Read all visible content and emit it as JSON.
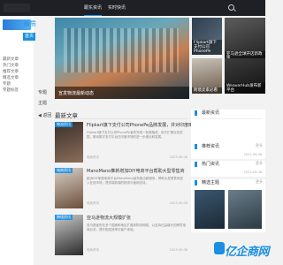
{
  "topbar": {
    "nav": [
      "跟东资讯",
      "实时快讯"
    ]
  },
  "sidebar": {
    "title": "极质",
    "home": "首页",
    "items": [
      "最新文章",
      "热门文章",
      "推荐文章",
      "精选文章",
      "专题",
      "专题标签"
    ],
    "buttons": [
      "专题",
      "主题"
    ],
    "back": "◀ 返回"
  },
  "hero": {
    "caption": "宣发物流最新动态"
  },
  "minis": [
    {
      "caption": "Flipkart旗下支付公司PhonePe"
    },
    {
      "caption": "亚马逊全球开店新政策"
    },
    {
      "caption": "跨境卖家必看"
    },
    {
      "caption": "WeaverHub发布新平台"
    }
  ],
  "section": {
    "title": "最新文章"
  },
  "articles": [
    {
      "tag": "物流资讯",
      "title": "Flipkart旗下支付公司PhonePe品牌发展，并对印度B2B进行融资",
      "desc": "Flipkart旗下支付公司PhonePe宣布完成一轮新融资，用于扩展业务范围，推动数字支付平台在印度市场的进一步增长和发展。",
      "meta": "电商资讯",
      "date": "2023-09-08"
    },
    {
      "tag": "电商资讯",
      "title": "ManoMano推新增加DIY电商平台帮助大型零售商",
      "desc": "欧洲DIY家居电商平台ManoMano宣布推出新服务，帮助大型零售商进入在线市场，提供端到端的物流与营销支持。",
      "meta": "电商资讯",
      "date": "2023-09-08"
    },
    {
      "tag": "跨境资讯",
      "title": "亚马逊物流大规模扩张",
      "desc": "亚马逊宣布在多个国家和地区扩展其物流网络，以支持日益增长的跨境电商业务，提升配送效率与客户体验。",
      "meta": "电商资讯",
      "date": "2023-09-08"
    }
  ],
  "right_panels": [
    {
      "head": "最新资讯",
      "more": "更多",
      "items": [
        {
          "title": "",
          "date": ""
        },
        {
          "title": "",
          "date": ""
        }
      ]
    },
    {
      "head": "推荐资讯",
      "more": "更多",
      "items": [
        {
          "title": "",
          "date": "2023-09-08"
        }
      ]
    },
    {
      "head": "热门资讯",
      "more": "更多",
      "items": [
        {
          "title": "",
          "date": "2023-09-08"
        }
      ]
    },
    {
      "head": "精选主题",
      "more": "更多",
      "items": []
    }
  ],
  "watermark": {
    "text": "亿企商网"
  }
}
